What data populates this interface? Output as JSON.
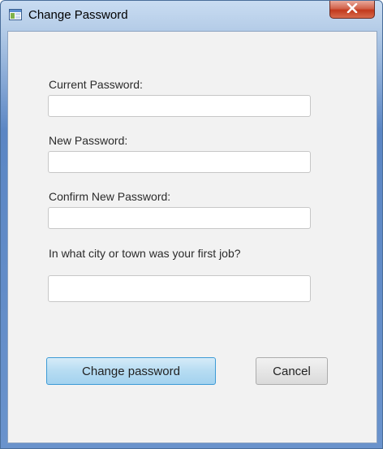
{
  "window": {
    "title": "Change Password",
    "icons": {
      "app": "window-icon",
      "close": "close-icon"
    }
  },
  "form": {
    "current_password_label": "Current Password:",
    "new_password_label": "New Password:",
    "confirm_password_label": "Confirm New Password:",
    "security_question_label": "In what city or town was your first job?",
    "current_password_value": "",
    "new_password_value": "",
    "confirm_password_value": "",
    "security_answer_value": ""
  },
  "buttons": {
    "change_label": "Change password",
    "cancel_label": "Cancel"
  },
  "colors": {
    "primary_border": "#3d9bd6",
    "primary_fill": "#b6dcf2",
    "close_red": "#c2391c",
    "client_bg": "#f2f2f2"
  }
}
